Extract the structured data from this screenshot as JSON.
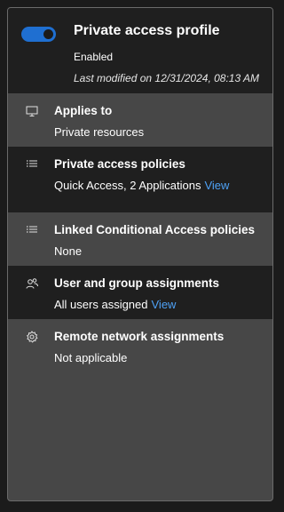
{
  "profile": {
    "title": "Private access profile",
    "status": "Enabled",
    "last_modified": "Last modified on 12/31/2024, 08:13 AM",
    "toggle_on": true
  },
  "sections": [
    {
      "icon": "monitor-icon",
      "label": "Applies to",
      "value": "Private resources",
      "link": ""
    },
    {
      "icon": "list-icon",
      "label": "Private access policies",
      "value": "Quick Access, 2 Applications",
      "link": "View"
    },
    {
      "icon": "list-icon",
      "label": "Linked Conditional Access policies",
      "value": "None",
      "link": ""
    },
    {
      "icon": "users-icon",
      "label": "User and group assignments",
      "value": "All users assigned",
      "link": "View"
    },
    {
      "icon": "gear-icon",
      "label": "Remote network assignments",
      "value": "Not applicable",
      "link": ""
    }
  ],
  "colors": {
    "accent": "#1f6fd1",
    "link": "#4ea1f5",
    "panel_dark": "#1f1f1f",
    "panel_light": "#474747"
  }
}
